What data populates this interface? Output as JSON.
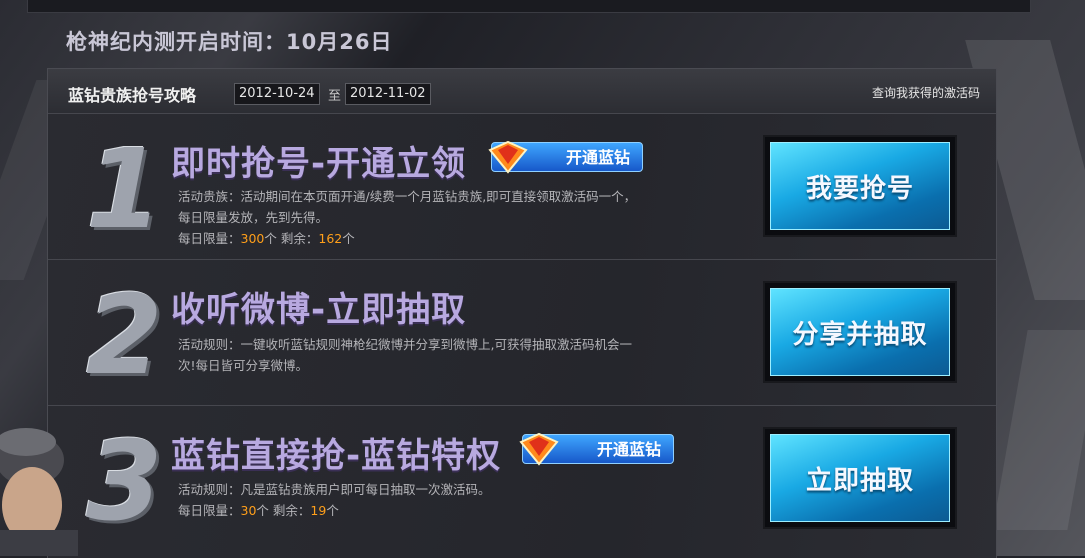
{
  "banner": {
    "title": "枪神纪内测开启时间：10月26日"
  },
  "panel": {
    "title": "蓝钻贵族抢号攻略",
    "date_start": "2012-10-24",
    "date_sep": "至",
    "date_end": "2012-11-02",
    "query_link": "查询我获得的激活码"
  },
  "rows": [
    {
      "number": "1",
      "title": "即时抢号-开通立领",
      "badge": "开通蓝钻",
      "desc_lines": [
        "活动贵族：活动期间在本页面开通/续费一个月蓝钻贵族,即可直接领取激活码一个，",
        "每日限量发放，先到先得。"
      ],
      "quota_label": "每日限量：",
      "quota_value": "300",
      "quota_unit": "个",
      "remain_label": " 剩余：",
      "remain_value": "162",
      "remain_unit": "个",
      "button": "我要抢号"
    },
    {
      "number": "2",
      "title": "收听微博-立即抽取",
      "desc_lines": [
        "活动规则：一键收听蓝钻规则神枪纪微博并分享到微博上,可获得抽取激活码机会一",
        "次!每日皆可分享微博。"
      ],
      "button": "分享并抽取"
    },
    {
      "number": "3",
      "title": "蓝钻直接抢-蓝钻特权",
      "badge": "开通蓝钻",
      "desc_lines": [
        "活动规则：凡是蓝钻贵族用户即可每日抽取一次激活码。"
      ],
      "quota_label": "每日限量：",
      "quota_value": "30",
      "quota_unit": "个",
      "remain_label": " 剩余：",
      "remain_value": "19",
      "remain_unit": "个",
      "button": "立即抽取"
    }
  ],
  "colors": {
    "accent_blue": "#19a9e4",
    "title_purple": "#b8a9e0",
    "highlight": "#ff9f1a"
  },
  "icons": [
    "diamond-gem-icon"
  ]
}
